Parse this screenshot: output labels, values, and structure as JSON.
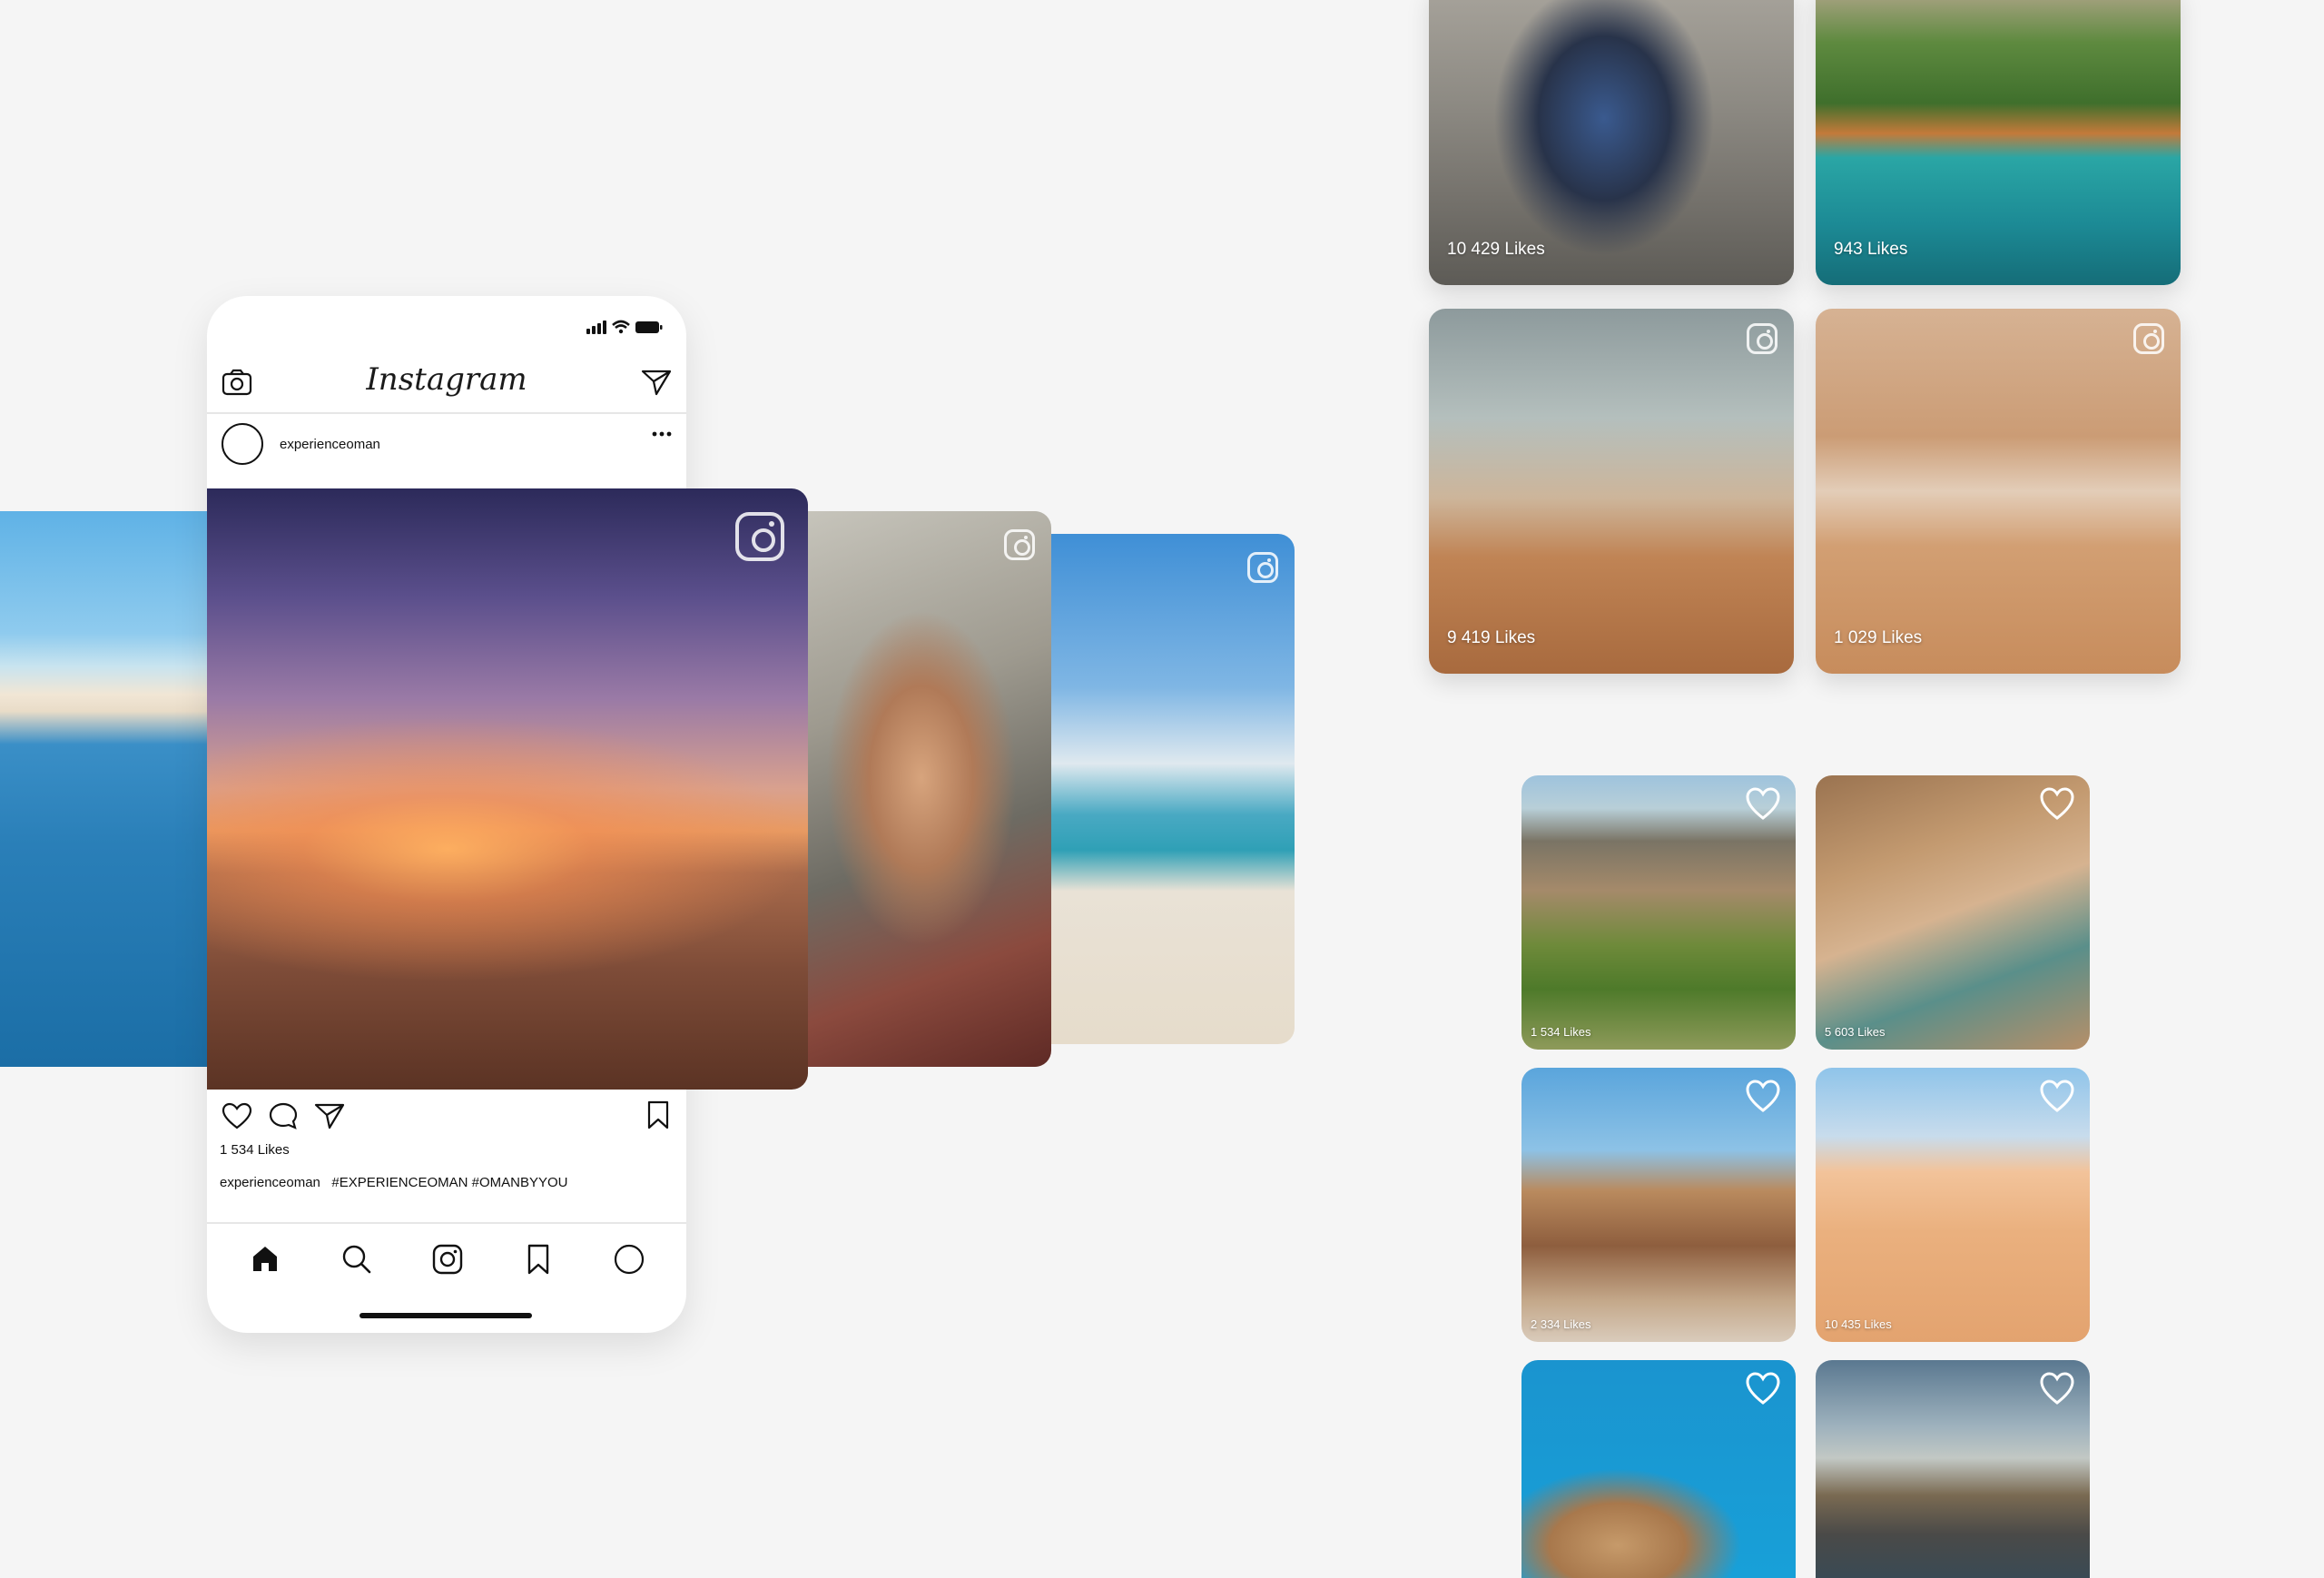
{
  "app": {
    "logo_text": "Instagram"
  },
  "post": {
    "username": "experienceoman",
    "likes": "1 534 Likes",
    "caption_user": "experienceoman",
    "caption_tags": "#EXPERIENCEOMAN #OMANBYYOU"
  },
  "icons": {
    "camera": "camera-icon",
    "send": "send-icon",
    "more": "more-icon",
    "heart": "heart-icon",
    "comment": "comment-icon",
    "bookmark": "bookmark-icon",
    "home": "home-icon",
    "search": "search-icon",
    "instagram": "instagram-icon",
    "profile": "profile-icon"
  },
  "grid_large": [
    {
      "likes": "10 429 Likes"
    },
    {
      "likes": "943 Likes"
    },
    {
      "likes": "9 419 Likes"
    },
    {
      "likes": "1 029 Likes"
    }
  ],
  "grid_small": [
    {
      "likes": "1 534 Likes"
    },
    {
      "likes": "5 603 Likes"
    },
    {
      "likes": "2 334 Likes"
    },
    {
      "likes": "10 435 Likes"
    }
  ],
  "colors": {
    "background": "#f5f5f5",
    "phone": "#ffffff",
    "text": "#111111"
  }
}
